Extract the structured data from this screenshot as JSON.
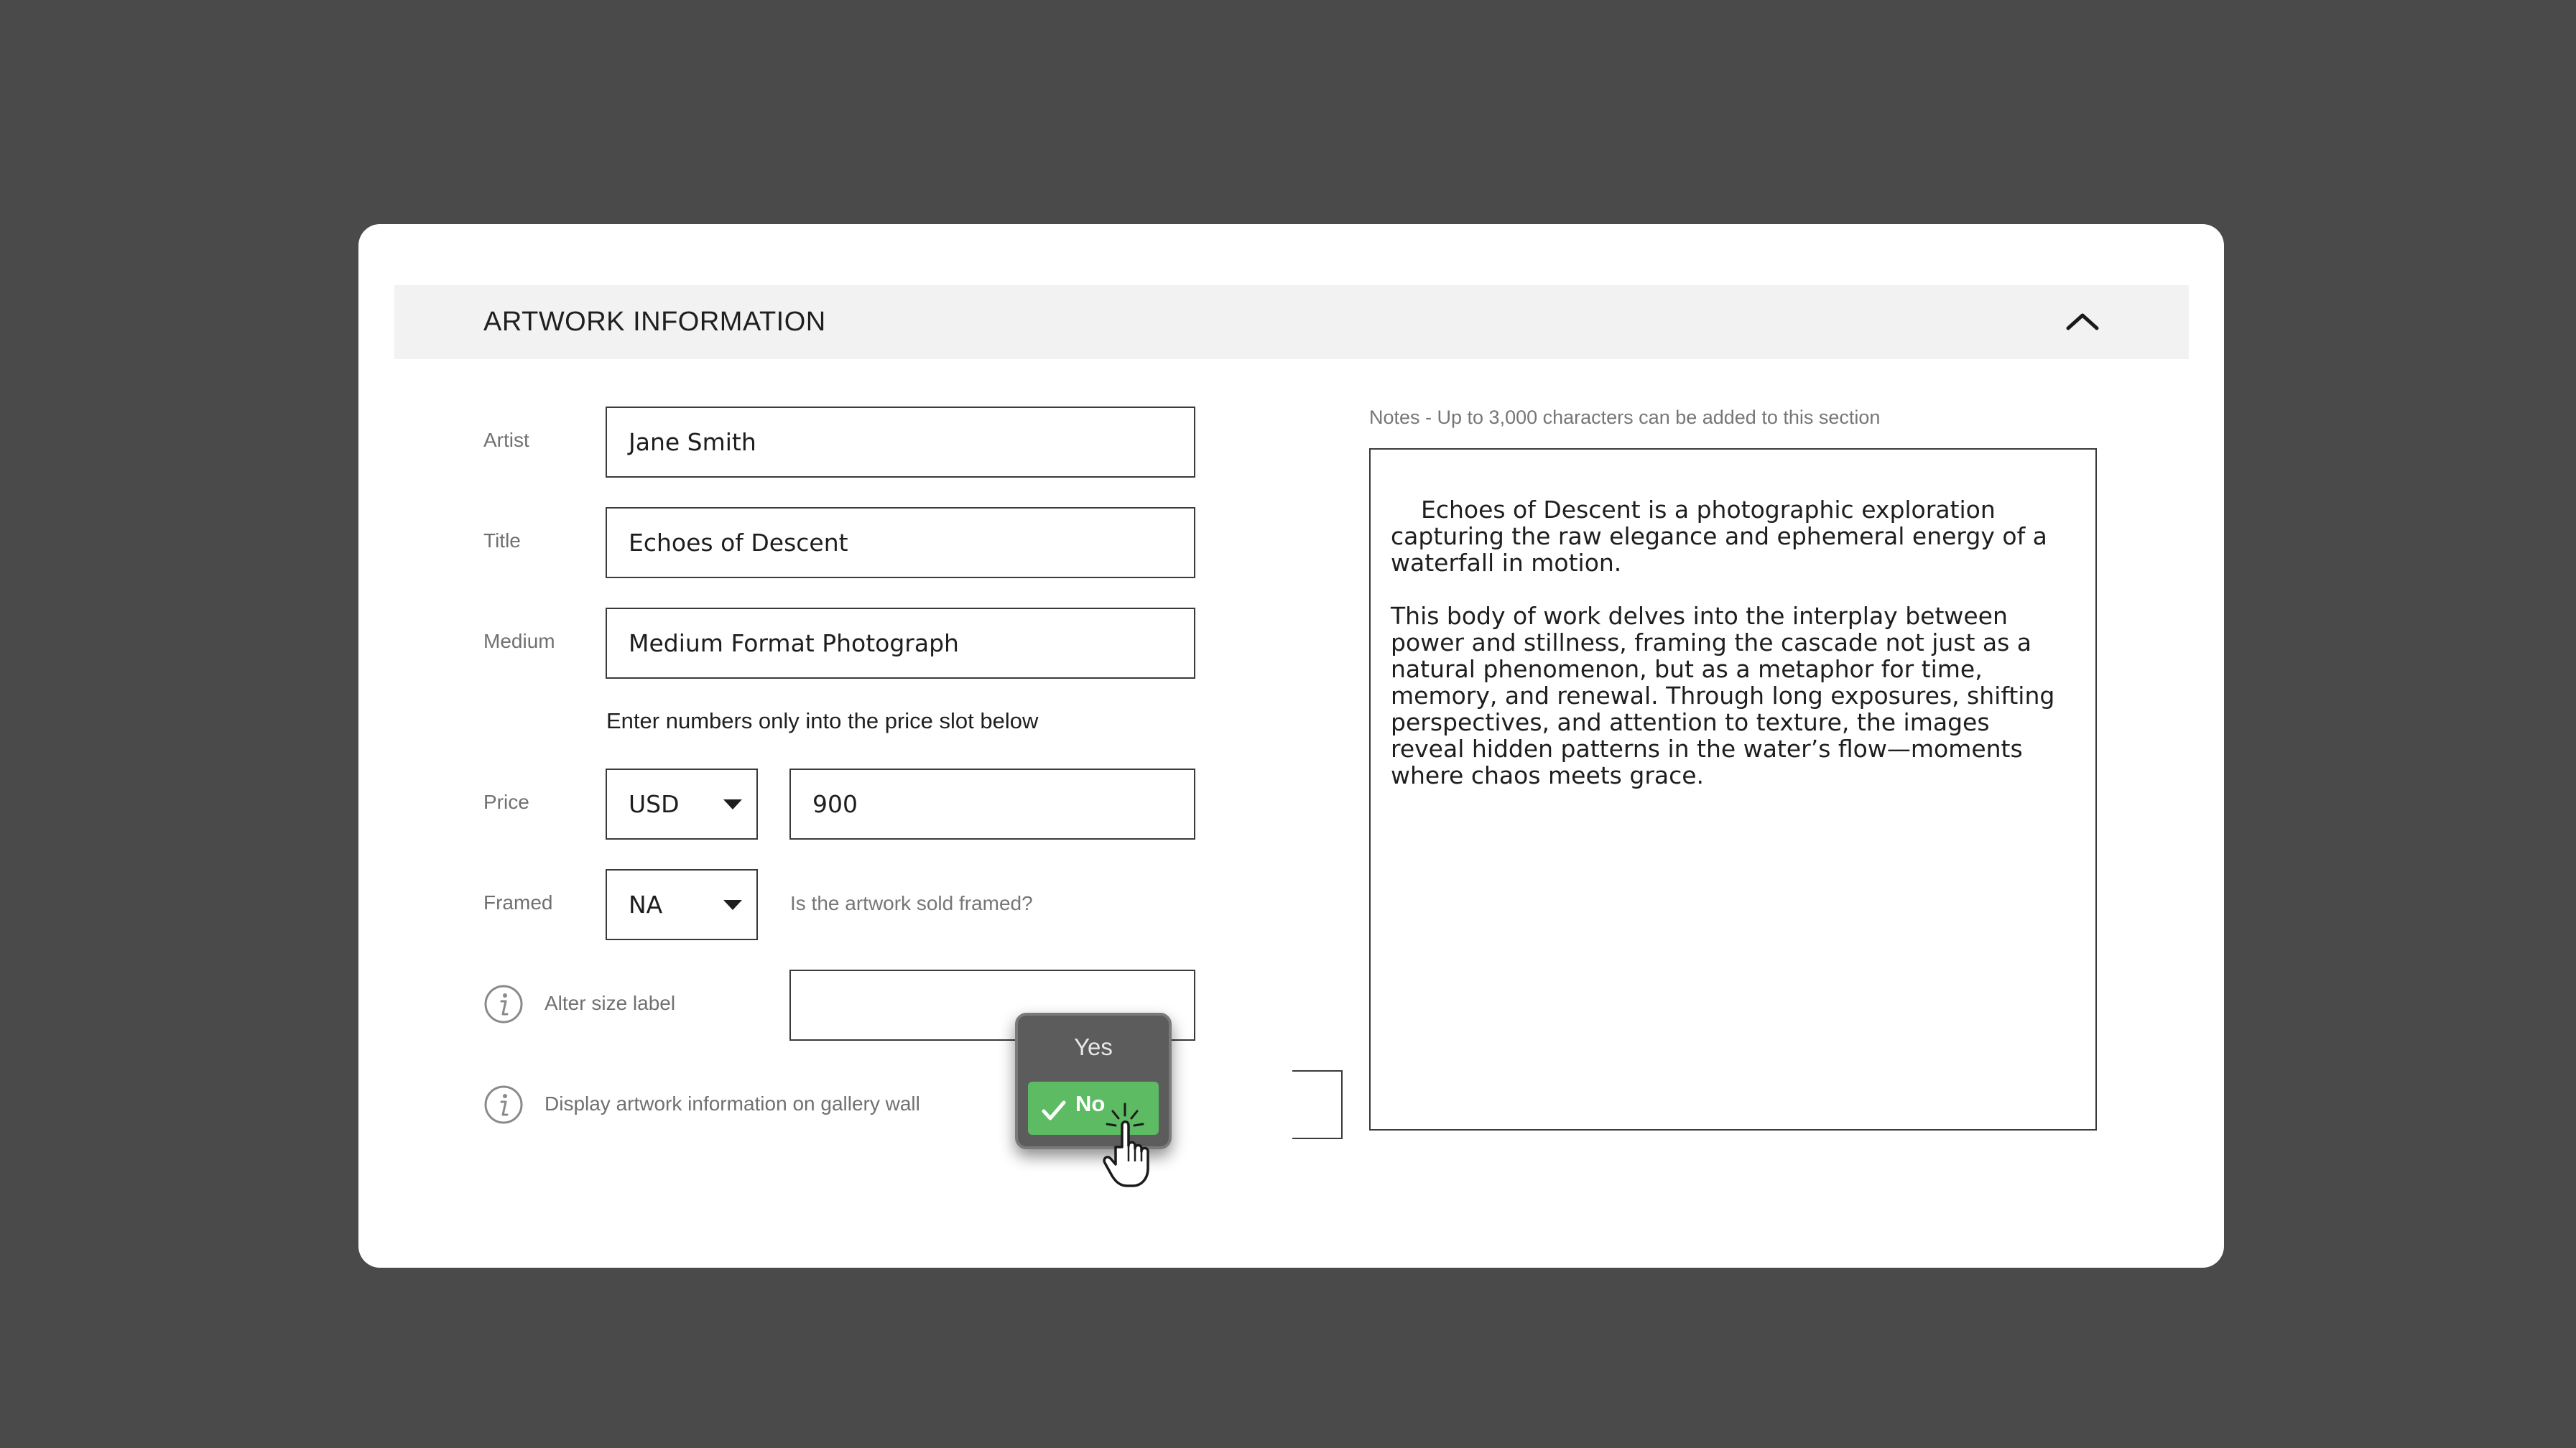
{
  "section": {
    "title": "ARTWORK INFORMATION",
    "toggle_icon": "chevron-up-icon"
  },
  "form": {
    "artist": {
      "label": "Artist",
      "value": "Jane Smith"
    },
    "title": {
      "label": "Title",
      "value": "Echoes of Descent"
    },
    "medium": {
      "label": "Medium",
      "value": "Medium Format Photograph"
    },
    "price_instruction": "Enter numbers only into the price slot below",
    "price": {
      "label": "Price",
      "currency": "USD",
      "value": "900"
    },
    "framed": {
      "label": "Framed",
      "value": "NA",
      "hint": "Is the artwork sold framed?"
    },
    "alter_size": {
      "label": "Alter size label",
      "value": "",
      "icon": "info-icon"
    },
    "display_info": {
      "label": "Display artwork information on gallery wall",
      "icon": "info-icon"
    }
  },
  "notes": {
    "label": "Notes - Up to 3,000 characters can be added to this section",
    "text": "Echoes of Descent is a photographic exploration\ncapturing the raw elegance and ephemeral energy of a\nwaterfall in motion.\n\nThis body of work delves into the interplay between\npower and stillness, framing the cascade not just as a\nnatural phenomenon, but as a metaphor for time,\nmemory, and renewal. Through long exposures, shifting\nperspectives, and attention to texture, the images\nreveal hidden patterns in the water’s flow—moments\nwhere chaos meets grace."
  },
  "dropdown": {
    "options": [
      "Yes",
      "No"
    ],
    "selected": "No",
    "selected_icon": "checkmark-icon"
  },
  "colors": {
    "background": "#4a4a4a",
    "card": "#ffffff",
    "header_bar": "#f2f2f2",
    "selected_option": "#5dbb63",
    "popup": "#5c5c5c"
  }
}
